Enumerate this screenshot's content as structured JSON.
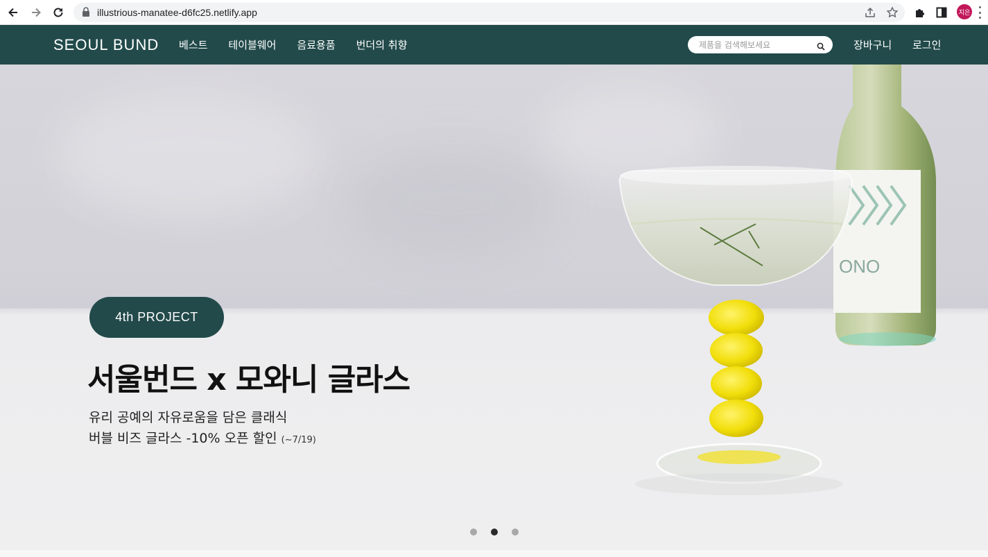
{
  "browser": {
    "url": "illustrious-manatee-d6fc25.netlify.app",
    "profile_initials": "지은",
    "profile_color": "#c2185b"
  },
  "header": {
    "logo": "SEOUL BUND",
    "background": "#224a4a",
    "menu": [
      {
        "label": "베스트"
      },
      {
        "label": "테이블웨어"
      },
      {
        "label": "음료용품"
      },
      {
        "label": "번더의 취향"
      }
    ],
    "search": {
      "placeholder": "제품을 검색해보세요",
      "value": ""
    },
    "cart_label": "장바구니",
    "login_label": "로그인"
  },
  "hero": {
    "badge": "4th PROJECT",
    "headline": "서울번드 x 모와니 글라스",
    "subtitle_line1": "유리 공예의 자유로움을 담은 클래식",
    "subtitle_line2": "버블 비즈 글라스 -10% 오픈 할인",
    "subtitle_note": "(~7/19)",
    "bottle_label": "ONO",
    "slides": 3,
    "active_slide": 2
  },
  "icons": {
    "back": "back-arrow-icon",
    "forward": "forward-arrow-icon",
    "reload": "reload-icon",
    "lock": "lock-icon",
    "share": "share-icon",
    "bookmark": "star-icon",
    "extensions": "puzzle-icon",
    "sidepanel": "side-panel-icon",
    "menu": "kebab-menu-icon",
    "search": "search-icon"
  }
}
